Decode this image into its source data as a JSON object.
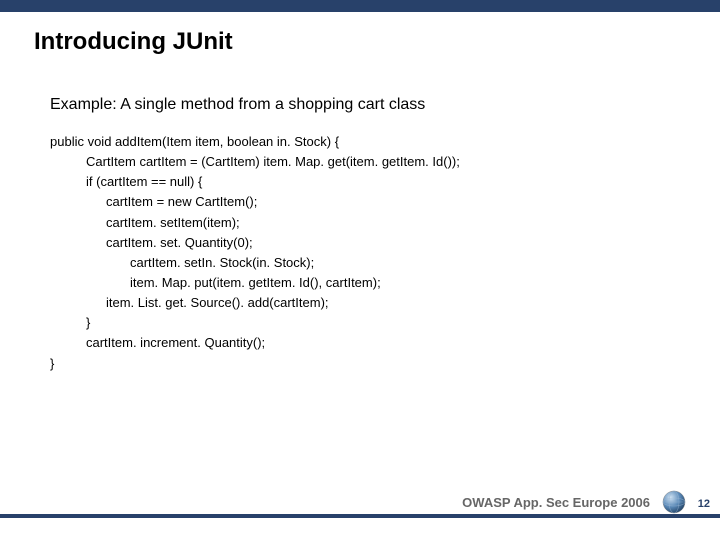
{
  "title": "Introducing JUnit",
  "example_label": "Example: A single method from a shopping cart class",
  "code": {
    "l0": "public void addItem(Item item, boolean in. Stock) {",
    "l1": "CartItem cartItem = (CartItem) item. Map. get(item. getItem. Id());",
    "l2": "if (cartItem == null) {",
    "l3": "cartItem = new CartItem();",
    "l4": "cartItem. setItem(item);",
    "l5": "cartItem. set. Quantity(0);",
    "l6": "cartItem. setIn. Stock(in. Stock);",
    "l7": "item. Map. put(item. getItem. Id(), cartItem);",
    "l8": "item. List. get. Source(). add(cartItem);",
    "l9": "}",
    "l10": "cartItem. increment. Quantity();",
    "l11": "}"
  },
  "footer": "OWASP App. Sec Europe 2006",
  "pagenum": "12"
}
